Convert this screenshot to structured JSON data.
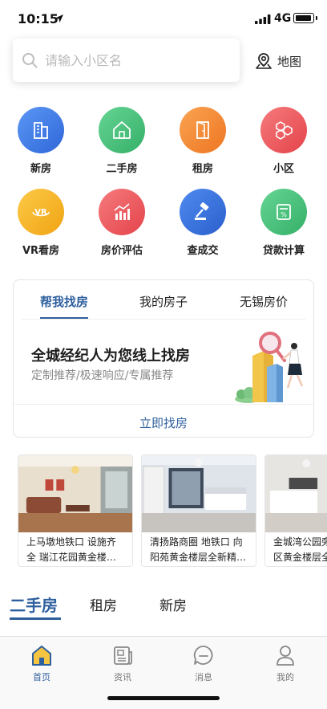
{
  "status_bar": {
    "time": "10:15",
    "network": "4G",
    "battery_level": 0.85
  },
  "search": {
    "placeholder": "请输入小区名"
  },
  "map_button": {
    "label": "地图"
  },
  "quick_menu": [
    {
      "label": "新房",
      "icon": "building-icon",
      "color": "#3d7bea"
    },
    {
      "label": "二手房",
      "icon": "house-icon",
      "color": "#47c27a"
    },
    {
      "label": "租房",
      "icon": "door-icon",
      "color": "#f4892e"
    },
    {
      "label": "小区",
      "icon": "hexagons-icon",
      "color": "#ef5a5e"
    },
    {
      "label": "VR看房",
      "icon": "vr-icon",
      "color": "#f6b326"
    },
    {
      "label": "房价评估",
      "icon": "price-chart-icon",
      "color": "#ef5a5e"
    },
    {
      "label": "查成交",
      "icon": "gavel-icon",
      "color": "#3d7bea"
    },
    {
      "label": "贷款计算",
      "icon": "calculator-icon",
      "color": "#47c27a"
    }
  ],
  "finder_card": {
    "tabs": [
      "帮我找房",
      "我的房子",
      "无锡房价"
    ],
    "active_tab": 0,
    "title": "全城经纪人为您线上找房",
    "subtitle": "定制推荐/极速响应/专属推荐",
    "button": "立即找房"
  },
  "listings": [
    {
      "line1": "上马墩地铁口 设施齐",
      "line2": "全 瑞江花园黄金楼…"
    },
    {
      "line1": "清扬路商圈 地铁口 向",
      "line2": "阳苑黄金楼层全新精…"
    },
    {
      "line1": "金城湾公园旁",
      "line2": "区黄金楼层全"
    }
  ],
  "house_tabs": [
    "二手房",
    "租房",
    "新房"
  ],
  "bottom_nav": [
    {
      "label": "首页",
      "icon": "home-icon",
      "active": true
    },
    {
      "label": "资讯",
      "icon": "newspaper-icon",
      "active": false
    },
    {
      "label": "消息",
      "icon": "message-bubble-icon",
      "active": false
    },
    {
      "label": "我的",
      "icon": "user-icon",
      "active": false
    }
  ],
  "colors": {
    "accent": "#2e5f9e",
    "placeholder": "#b9b9b9"
  }
}
